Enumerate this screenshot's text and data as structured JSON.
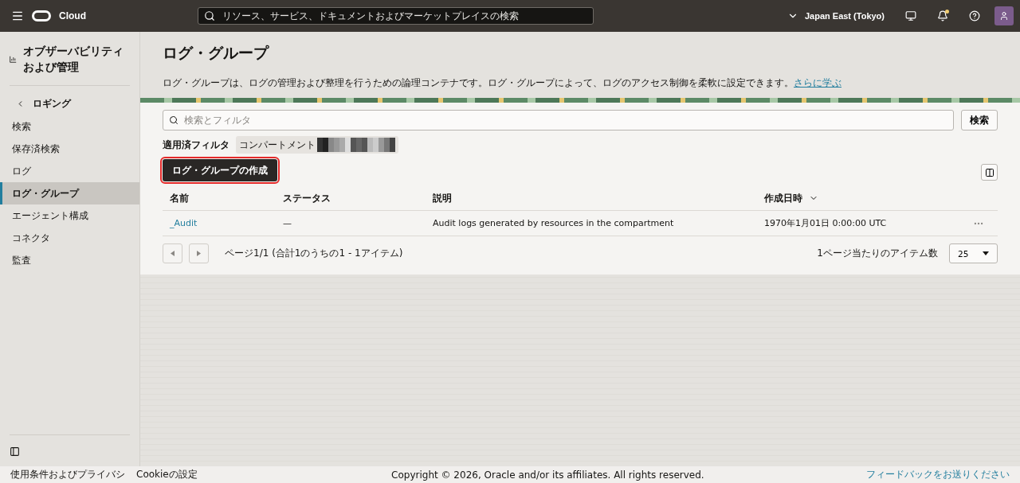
{
  "header": {
    "brand": "Cloud",
    "search": {
      "placeholder": "リソース、サービス、ドキュメントおよびマーケットプレイスの検索"
    },
    "region": "Japan East (Tokyo)",
    "notifications_unread": true
  },
  "sidebar": {
    "title": "オブザーバビリティおよび管理",
    "back": "ロギング",
    "items": [
      {
        "label": "検索",
        "selected": false
      },
      {
        "label": "保存済検索",
        "selected": false
      },
      {
        "label": "ログ",
        "selected": false
      },
      {
        "label": "ログ・グループ",
        "selected": true
      },
      {
        "label": "エージェント構成",
        "selected": false
      },
      {
        "label": "コネクタ",
        "selected": false
      },
      {
        "label": "監査",
        "selected": false
      }
    ]
  },
  "page": {
    "title": "ログ・グループ",
    "description": "ログ・グループは、ログの管理および整理を行うための論理コンテナです。ログ・グループによって、ログのアクセス制御を柔軟に設定できます。",
    "learn_more": "さらに学ぶ"
  },
  "filter": {
    "placeholder": "検索とフィルタ",
    "search_button": "検索",
    "applied_label": "適用済フィルタ",
    "chip_label": "コンパートメント"
  },
  "create_button": "ログ・グループの作成",
  "table": {
    "columns": [
      {
        "label": "名前",
        "sorted": false
      },
      {
        "label": "ステータス",
        "sorted": false
      },
      {
        "label": "説明",
        "sorted": false
      },
      {
        "label": "作成日時",
        "sorted": true
      }
    ],
    "rows": [
      {
        "name": "_Audit",
        "status": "—",
        "description": "Audit logs generated by resources in the compartment",
        "created": "1970年1月01日 0:00:00 UTC"
      }
    ]
  },
  "pagination": {
    "summary": "ページ1/1 (合計1のうちの1 - 1アイテム)",
    "per_page_label": "1ページ当たりのアイテム数",
    "per_page": "25"
  },
  "footer": {
    "links": [
      "使用条件およびプライバシ",
      "Cookieの設定"
    ],
    "copyright": "Copyright © 2026, Oracle and/or its affiliates. All rights reserved.",
    "feedback": "フィードバックをお送りください"
  }
}
